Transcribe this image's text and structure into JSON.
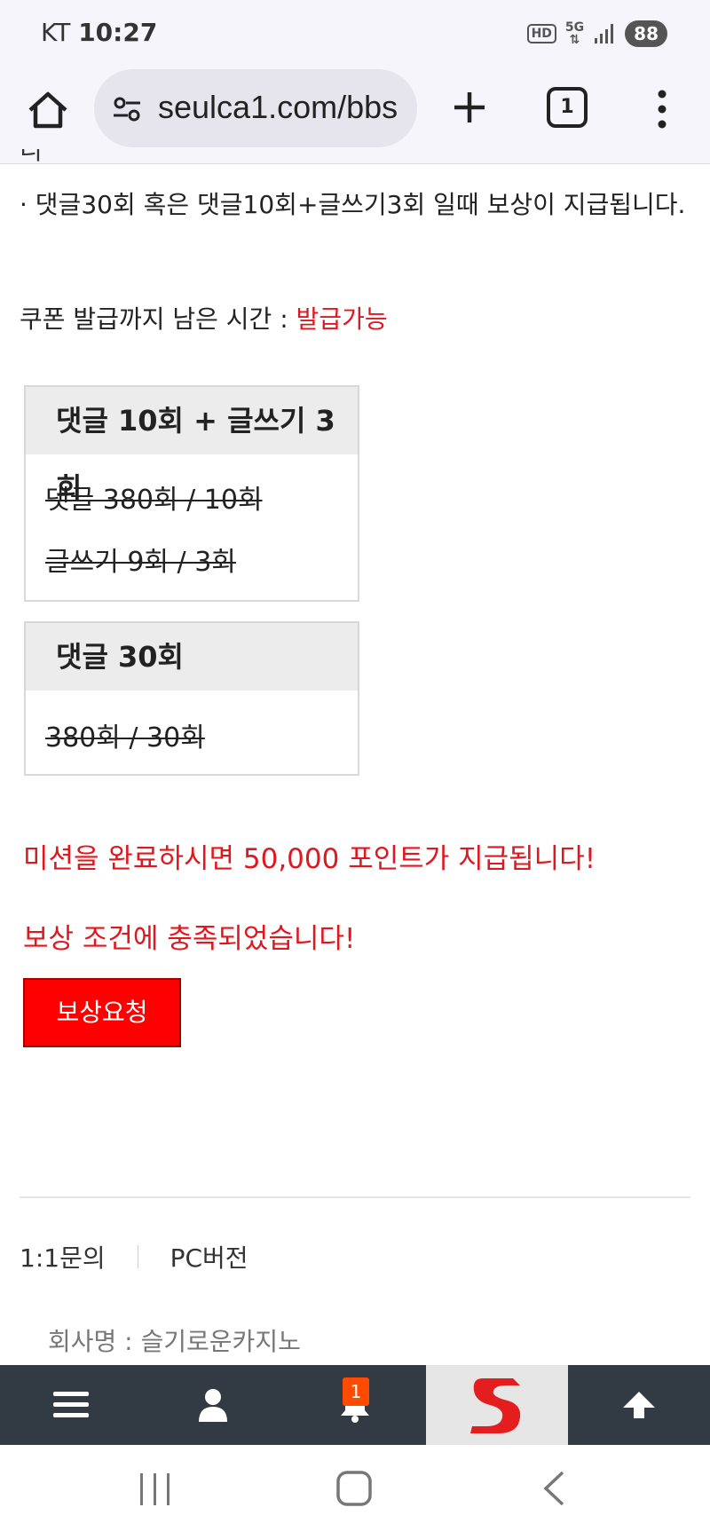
{
  "status_bar": {
    "carrier": "KT",
    "time": "10:27",
    "hd": "HD",
    "network": "5G",
    "battery": "88"
  },
  "browser": {
    "url": "seulca1.com/bbs",
    "tab_count": "1"
  },
  "content": {
    "cut_text": "니다.",
    "condition_text": " · 댓글30회 혹은 댓글10회+글쓰기3회 일때 보상이 지급됩니다.",
    "coupon_label": "쿠폰 발급까지 남은 시간 : ",
    "coupon_status": "발급가능",
    "box1": {
      "title": "댓글 10회 + 글쓰기 3회",
      "row1": "댓글 380회 / 10회",
      "row2": "글쓰기 9회 / 3회"
    },
    "box2": {
      "title": "댓글 30회",
      "row1": "380회 / 30회"
    },
    "mission_msg": "미션을 완료하시면 50,000 포인트가 지급됩니다!",
    "met_msg": "보상 조건에 충족되었습니다!",
    "reward_button": "보상요청"
  },
  "footer": {
    "inquiry": "1:1문의",
    "pc_version": "PC버전",
    "company": "회사명 : 슬기로운카지노"
  },
  "bottom_nav": {
    "notification_count": "1"
  },
  "colors": {
    "accent_red": "#e0171e",
    "button_red": "#ff0000",
    "nav_bg": "#323a43"
  }
}
